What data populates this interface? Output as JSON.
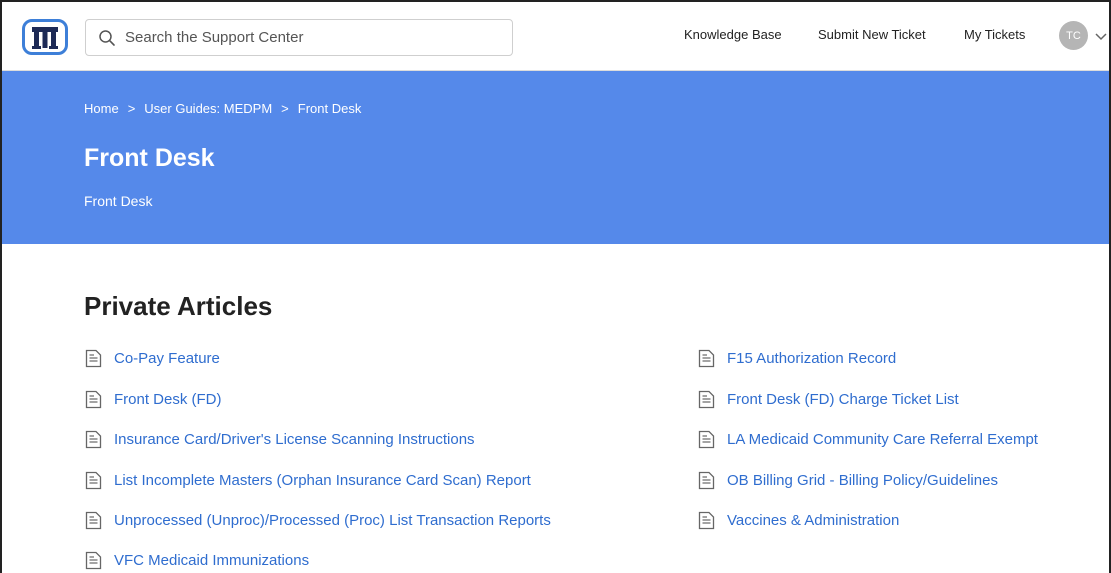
{
  "header": {
    "logo_letter": "M",
    "search": {
      "placeholder": "Search the Support Center",
      "value": ""
    },
    "nav": [
      {
        "label": "Knowledge Base"
      },
      {
        "label": "Submit New Ticket"
      },
      {
        "label": "My Tickets"
      }
    ],
    "user": {
      "initials": "TC"
    }
  },
  "banner": {
    "breadcrumb": [
      "Home",
      "User Guides: MEDPM",
      "Front Desk"
    ],
    "breadcrumb_separator": ">",
    "title": "Front Desk",
    "subtitle": "Front Desk"
  },
  "section": {
    "title": "Private Articles",
    "left_articles": [
      "Co-Pay Feature",
      "Front Desk (FD)",
      "Insurance Card/Driver's License Scanning Instructions",
      "List Incomplete Masters (Orphan Insurance Card Scan) Report",
      "Unprocessed (Unproc)/Processed (Proc) List Transaction Reports",
      "VFC Medicaid Immunizations"
    ],
    "right_articles": [
      "F15 Authorization Record",
      "Front Desk (FD) Charge Ticket List",
      "LA Medicaid Community Care Referral Exempt",
      "OB Billing Grid - Billing Policy/Guidelines",
      "Vaccines & Administration"
    ]
  },
  "colors": {
    "banner": "#5589ea",
    "link": "#2f6dcf",
    "logo": "#3d7fd8"
  }
}
